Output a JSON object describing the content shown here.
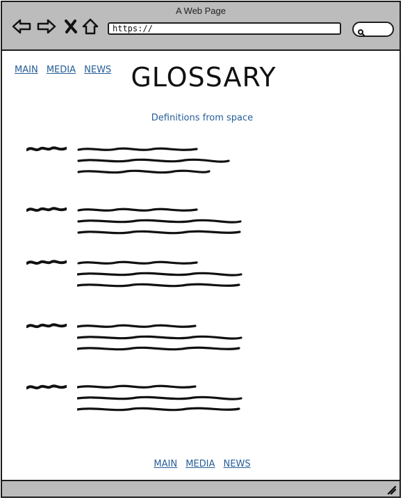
{
  "window": {
    "title": "A Web Page"
  },
  "browser": {
    "url": "https://",
    "icons": {
      "back": "back-arrow-icon",
      "forward": "forward-arrow-icon",
      "close": "close-icon",
      "home": "home-icon",
      "search": "search-icon",
      "resize": "resize-grip-icon"
    }
  },
  "nav": {
    "top": [
      "MAIN",
      "MEDIA",
      "NEWS"
    ],
    "bottom": [
      "MAIN",
      "MEDIA",
      "NEWS"
    ]
  },
  "page": {
    "title": "GLOSSARY",
    "subtitle": "Definitions from space"
  },
  "colors": {
    "link": "#255d97",
    "chrome": "#bcbcbc",
    "ink": "#111111"
  },
  "entries": [
    {
      "term": "scribble-term-1",
      "definition": "scribble-definition-1"
    },
    {
      "term": "scribble-term-2",
      "definition": "scribble-definition-2"
    },
    {
      "term": "scribble-term-3",
      "definition": "scribble-definition-3"
    },
    {
      "term": "scribble-term-4",
      "definition": "scribble-definition-4"
    },
    {
      "term": "scribble-term-5",
      "definition": "scribble-definition-5"
    }
  ]
}
